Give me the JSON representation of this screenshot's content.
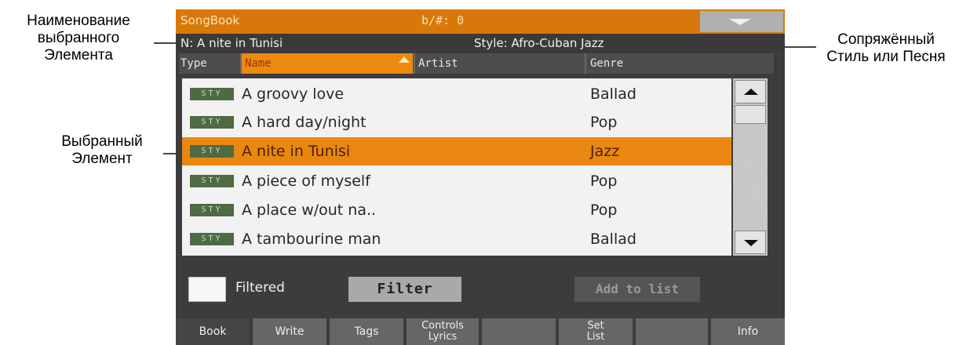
{
  "callouts": {
    "selected_name": [
      "Наименование",
      "выбранного",
      "Элемента"
    ],
    "selected_item": [
      "Выбранный",
      "Элемент"
    ],
    "linked_style": [
      "Сопряжённый",
      "Стиль или Песня"
    ]
  },
  "titlebar": {
    "app_title": "SongBook",
    "transpose": "b/#: 0",
    "menu_icon": "triangle-down-icon"
  },
  "infobar": {
    "selected_name": "N: A nite in Tunisi",
    "linked_style": "Style: Afro-Cuban Jazz"
  },
  "table": {
    "columns": [
      "Type",
      "Name",
      "Artist",
      "Genre"
    ],
    "sorted_column": "Name",
    "sort_direction": "ascending",
    "rows": [
      {
        "type": "STY",
        "name": "A groovy love",
        "artist": "",
        "genre": "Ballad"
      },
      {
        "type": "STY",
        "name": "A hard day/night",
        "artist": "",
        "genre": "Pop"
      },
      {
        "type": "STY",
        "name": "A nite in Tunisi",
        "artist": "",
        "genre": "Jazz"
      },
      {
        "type": "STY",
        "name": "A piece of myself",
        "artist": "",
        "genre": "Pop"
      },
      {
        "type": "STY",
        "name": "A place w/out na..",
        "artist": "",
        "genre": "Pop"
      },
      {
        "type": "STY",
        "name": "A tambourine man",
        "artist": "",
        "genre": "Ballad"
      }
    ],
    "selected_row": 2
  },
  "controls": {
    "filtered_label": "Filtered",
    "filtered_checked": false,
    "filter_button": "Filter",
    "add_to_list_button": "Add to list"
  },
  "tabs": [
    {
      "label": "Book"
    },
    {
      "label": "Write"
    },
    {
      "label": "Tags"
    },
    {
      "line1": "Controls",
      "line2": "Lyrics"
    },
    {
      "label": ""
    },
    {
      "line1": "Set",
      "line2": "List"
    },
    {
      "label": ""
    },
    {
      "label": "Info"
    }
  ],
  "colors": {
    "accent": "#ea8710",
    "titlebar": "#d9780a",
    "panel": "#3c3c3c",
    "list_bg": "#f2f2f2",
    "badge": "#4e6b43"
  }
}
